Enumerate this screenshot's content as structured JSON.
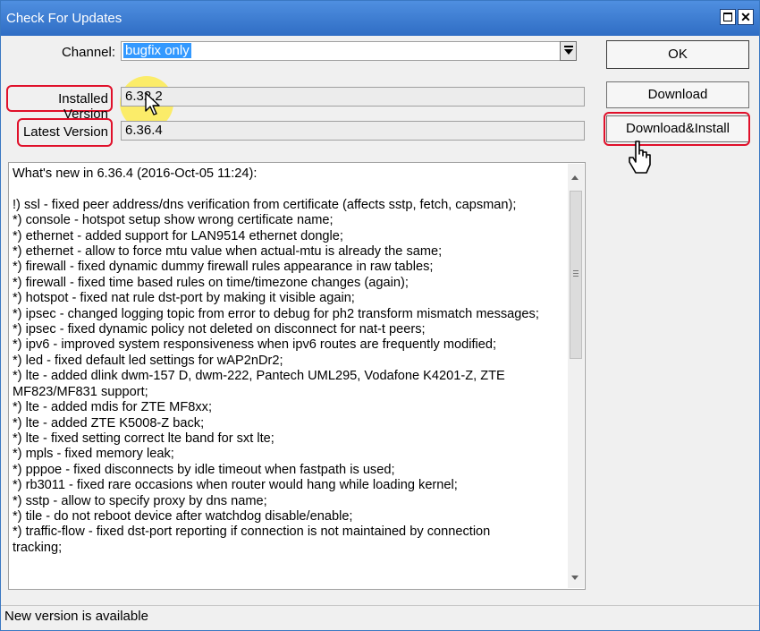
{
  "window": {
    "title": "Check For Updates"
  },
  "channel": {
    "label": "Channel:",
    "value": "bugfix only"
  },
  "installed": {
    "label": "Installed Version",
    "value": "6.32.2"
  },
  "latest": {
    "label": "Latest Version",
    "value": "6.36.4"
  },
  "buttons": {
    "ok": "OK",
    "download": "Download",
    "download_install": "Download&Install"
  },
  "changelog": {
    "lines": [
      "What's new in 6.36.4 (2016-Oct-05 11:24):",
      "",
      "!) ssl - fixed peer address/dns verification from certificate (affects sstp, fetch, capsman);",
      "*) console - hotspot setup show wrong certificate name;",
      "*) ethernet - added support for LAN9514 ethernet dongle;",
      "*) ethernet - allow to force mtu value when actual-mtu is already the same;",
      "*) firewall - fixed dynamic dummy firewall rules appearance in raw tables;",
      "*) firewall - fixed time based rules on time/timezone changes (again);",
      "*) hotspot - fixed nat rule dst-port by making it visible again;",
      "*) ipsec - changed logging topic from error to debug for ph2 transform mismatch messages;",
      "*) ipsec - fixed dynamic policy not deleted on disconnect for nat-t peers;",
      "*) ipv6 - improved system responsiveness when ipv6 routes are frequently modified;",
      "*) led - fixed default led settings for wAP2nDr2;",
      "*) lte - added dlink dwm-157 D, dwm-222, Pantech UML295, Vodafone K4201-Z, ZTE",
      "MF823/MF831 support;",
      "*) lte - added mdis for ZTE MF8xx;",
      "*) lte - added ZTE K5008-Z back;",
      "*) lte - fixed setting correct lte band for sxt lte;",
      "*) mpls - fixed memory leak;",
      "*) pppoe - fixed disconnects by idle timeout when fastpath is used;",
      "*) rb3011 - fixed rare occasions when router would hang while loading kernel;",
      "*) sstp - allow to specify proxy by dns name;",
      "*) tile - do not reboot device after watchdog disable/enable;",
      "*) traffic-flow - fixed dst-port reporting if connection is not maintained by connection",
      "tracking;"
    ]
  },
  "status": {
    "text": "New version is available"
  },
  "colors": {
    "titlebar": "#3c7fd6",
    "highlight_box": "#e0102a",
    "selection": "#3399ff"
  }
}
